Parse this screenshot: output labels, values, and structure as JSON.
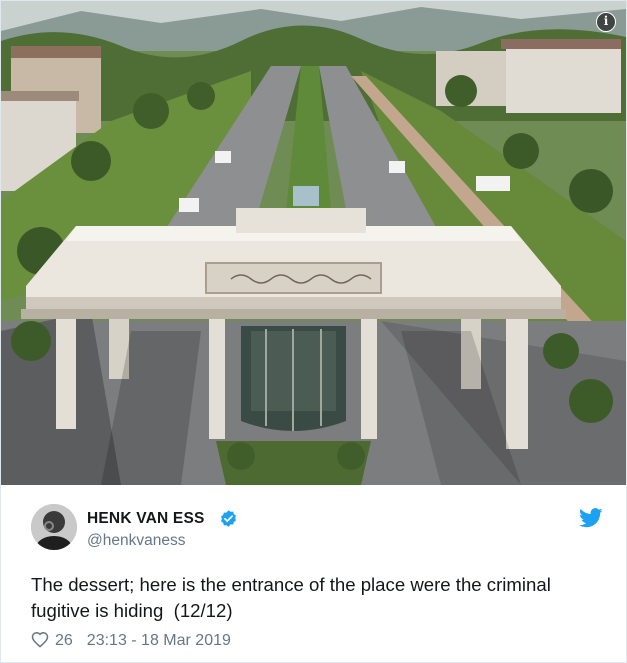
{
  "photo": {
    "sky_color": "#c9d2cf",
    "building_color": "#ebe7df",
    "lawn_color": "#6a8f3d",
    "road_color": "#7c7d7f"
  },
  "tweet": {
    "author_name": "HENK VAN ESS",
    "handle": "@henkvaness",
    "text": "The dessert; here is the entrance of the place were the criminal\nfugitive is hiding  (12/12)",
    "likes": "26",
    "timestamp": "23:13 - 18 Mar 2019",
    "icons": {
      "info": "info-icon",
      "verified": "verified-badge-icon",
      "bird": "twitter-bird-icon",
      "like": "heart-icon"
    },
    "colors": {
      "twitter_blue": "#1da1f2",
      "secondary_text": "#657786",
      "primary_text": "#14171a"
    }
  }
}
